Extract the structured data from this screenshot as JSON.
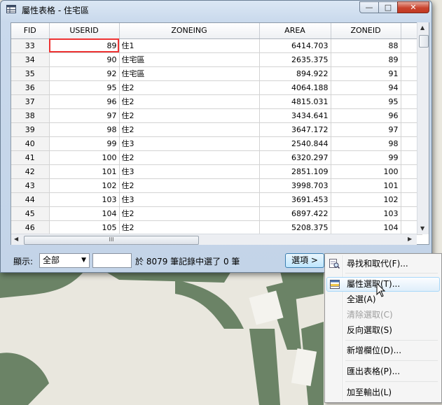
{
  "window": {
    "title": "屬性表格 - 住宅區",
    "minimize": "—",
    "maximize": "□",
    "close": "✕"
  },
  "table": {
    "columns": [
      "FID",
      "USERID",
      "ZONEING",
      "AREA",
      "ZONEID"
    ],
    "rows": [
      [
        "33",
        "89",
        "住1",
        "6414.703",
        "88"
      ],
      [
        "34",
        "90",
        "住宅區",
        "2635.375",
        "89"
      ],
      [
        "35",
        "92",
        "住宅區",
        "894.922",
        "91"
      ],
      [
        "36",
        "95",
        "住2",
        "4064.188",
        "94"
      ],
      [
        "37",
        "96",
        "住2",
        "4815.031",
        "95"
      ],
      [
        "38",
        "97",
        "住2",
        "3434.641",
        "96"
      ],
      [
        "39",
        "98",
        "住2",
        "3647.172",
        "97"
      ],
      [
        "40",
        "99",
        "住3",
        "2540.844",
        "98"
      ],
      [
        "41",
        "100",
        "住2",
        "6320.297",
        "99"
      ],
      [
        "42",
        "101",
        "住3",
        "2851.109",
        "100"
      ],
      [
        "43",
        "102",
        "住2",
        "3998.703",
        "101"
      ],
      [
        "44",
        "103",
        "住3",
        "3691.453",
        "102"
      ],
      [
        "45",
        "104",
        "住2",
        "6897.422",
        "103"
      ],
      [
        "46",
        "105",
        "住2",
        "5208.375",
        "104"
      ]
    ],
    "hscroll_grip": "III"
  },
  "footer": {
    "show_label": "顯示:",
    "show_value": "全部",
    "count_value": "",
    "status": "於 8079 筆記錄中選了 0 筆",
    "options_label": "選項 >"
  },
  "menu": {
    "items": [
      {
        "label": "尋找和取代(F)...",
        "icon": "find-replace-icon",
        "disabled": false
      },
      {
        "label": "屬性選取(T)...",
        "icon": "select-by-attributes-icon",
        "disabled": false,
        "highlighted": true
      },
      {
        "label": "全選(A)",
        "disabled": false
      },
      {
        "label": "清除選取(C)",
        "disabled": true
      },
      {
        "label": "反向選取(S)",
        "disabled": false
      },
      {
        "label": "新增欄位(D)...",
        "disabled": false
      },
      {
        "label": "匯出表格(P)...",
        "disabled": false
      },
      {
        "label": "加至輸出(L)",
        "disabled": false
      }
    ]
  },
  "colors": {
    "map_background": "#e9e7de",
    "map_features": "#6b8366",
    "menu_highlight_border": "#a8d8f9",
    "close_button": "#c9452f",
    "selected_cell_outline": "#ee3333"
  }
}
